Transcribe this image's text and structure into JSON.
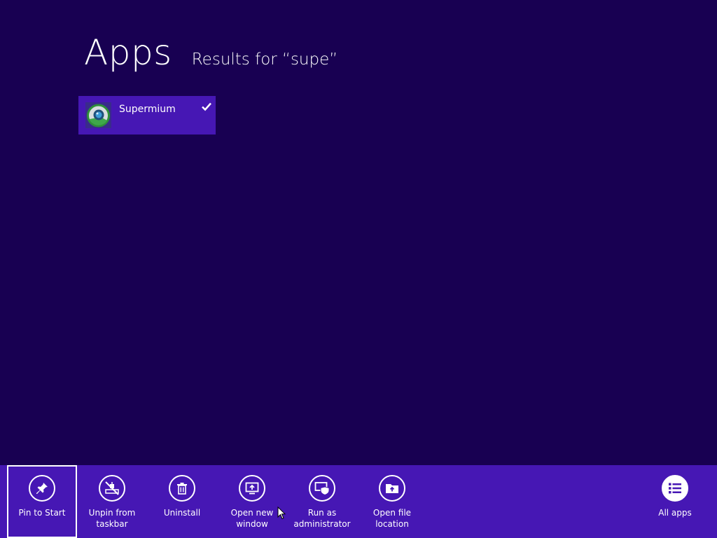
{
  "header": {
    "title": "Apps",
    "results_text": "Results for “supe”"
  },
  "results": [
    {
      "name": "Supermium",
      "icon": "supermium-logo-icon",
      "selected": true
    }
  ],
  "app_bar": {
    "commands": [
      {
        "label": "Pin to Start",
        "icon": "pin-icon"
      },
      {
        "label": "Unpin from\ntaskbar",
        "icon": "unpin-taskbar-icon"
      },
      {
        "label": "Uninstall",
        "icon": "trash-icon"
      },
      {
        "label": "Open new\nwindow",
        "icon": "new-window-icon"
      },
      {
        "label": "Run as\nadministrator",
        "icon": "shield-window-icon"
      },
      {
        "label": "Open file\nlocation",
        "icon": "folder-icon"
      }
    ],
    "all_apps": {
      "label": "All apps",
      "icon": "list-icon"
    }
  },
  "colors": {
    "background": "#180052",
    "accent": "#4617b4",
    "text": "#ffffff"
  }
}
